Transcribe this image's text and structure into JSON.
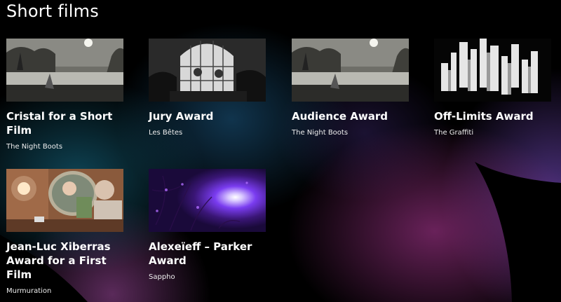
{
  "page_title": "Short films",
  "cards": [
    {
      "award": "Cristal for a Short Film",
      "film": "The Night Boots",
      "thumb_icon": "night-lake-still"
    },
    {
      "award": "Jury Award",
      "film": "Les Bêtes",
      "thumb_icon": "cathedral-window-still"
    },
    {
      "award": "Audience Award",
      "film": "The Night Boots",
      "thumb_icon": "night-lake-still"
    },
    {
      "award": "Off-Limits Award",
      "film": "The Graffiti",
      "thumb_icon": "white-blocks-still"
    },
    {
      "award": "Jean-Luc Xiberras Award for a First Film",
      "film": "Murmuration",
      "thumb_icon": "puppet-mirror-still"
    },
    {
      "award": "Alexeïeff – Parker Award",
      "film": "Sappho",
      "thumb_icon": "violet-glow-still"
    }
  ],
  "colors": {
    "background": "#000000",
    "text": "#ffffff",
    "accent_teal": "#1a7896",
    "accent_magenta": "#8c2d78",
    "accent_violet": "#6e46b4"
  }
}
